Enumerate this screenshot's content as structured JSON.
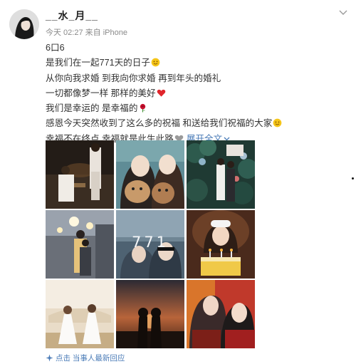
{
  "post": {
    "username": "__水_月__",
    "meta": "今天 02:27 来自 iPhone",
    "lines": [
      "6口6",
      "是我们在一起771天的日子",
      "从你向我求婚 到我向你求婚 再到年头的婚礼",
      "一切都像梦一样 那样的美好",
      "我们是幸运的 是幸福的",
      "感恩今天突然收到了这么多的祝福 和送给我们祝福的大家",
      "幸福不在终点 幸福就是此生此路"
    ],
    "expand_label": "展开全文",
    "photo_overlay_text": "771",
    "footer_label": "点击 当事人最新回应"
  },
  "icons": {
    "more": "chevron-down-icon",
    "smile": "smile-emoji-icon",
    "heart": "heart-emoji-icon",
    "rose": "rose-emoji-icon",
    "grey_heart": "grey-heart-emoji-icon",
    "expand": "chevron-down-icon",
    "footer": "sparkle-icon"
  },
  "colors": {
    "link": "#4a7bb7",
    "text": "#333333",
    "meta": "#8a8a8a",
    "heart": "#e0252b",
    "emoji": "#f5c518"
  }
}
